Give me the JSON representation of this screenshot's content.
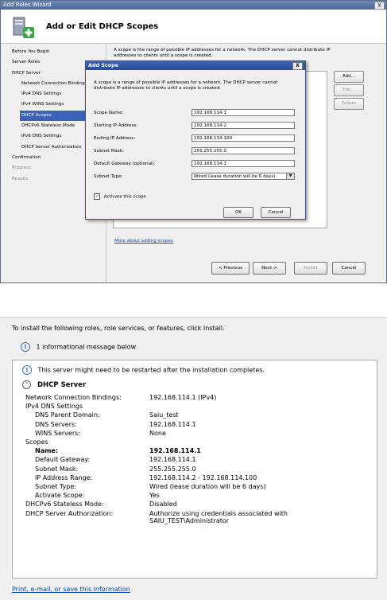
{
  "wizard": {
    "title": "Add Roles Wizard",
    "close_glyph": "X",
    "banner_title": "Add or Edit DHCP Scopes",
    "nav": [
      {
        "label": "Before You Begin",
        "level": 0,
        "state": "normal"
      },
      {
        "label": "Server Roles",
        "level": 0,
        "state": "normal"
      },
      {
        "label": "DHCP Server",
        "level": 0,
        "state": "normal"
      },
      {
        "label": "Network Connection Bindings",
        "level": 1,
        "state": "normal"
      },
      {
        "label": "IPv4 DNS Settings",
        "level": 1,
        "state": "normal"
      },
      {
        "label": "IPv4 WINS Settings",
        "level": 1,
        "state": "normal"
      },
      {
        "label": "DHCP Scopes",
        "level": 1,
        "state": "active"
      },
      {
        "label": "DHCPv6 Stateless Mode",
        "level": 1,
        "state": "normal"
      },
      {
        "label": "IPv6 DNS Settings",
        "level": 1,
        "state": "normal"
      },
      {
        "label": "DHCP Server Authorization",
        "level": 1,
        "state": "normal"
      },
      {
        "label": "Confirmation",
        "level": 0,
        "state": "normal"
      },
      {
        "label": "Progress",
        "level": 0,
        "state": "dim"
      },
      {
        "label": "Results",
        "level": 0,
        "state": "dim"
      }
    ],
    "main_description": "A scope is the range of possible IP addresses for a network. The DHCP server cannot distribute IP addresses to clients until a scope is created.",
    "buttons": {
      "add": "Add...",
      "edit": "Edit...",
      "delete": "Delete"
    },
    "more_link": "More about adding scopes",
    "footer": {
      "previous": "< Previous",
      "next": "Next >",
      "install": "Install",
      "cancel": "Cancel"
    }
  },
  "dialog": {
    "title": "Add Scope",
    "close_glyph": "X",
    "description": "A scope is a range of possible IP addresses for a network. The DHCP server cannot distribute IP addresses to clients until a scope is created.",
    "fields": [
      {
        "label": "Scope Name:",
        "value": "192.168.114.1"
      },
      {
        "label": "Starting IP Address:",
        "value": "192.168.114.2"
      },
      {
        "label": "Ending IP Address:",
        "value": "192.168.114.100"
      },
      {
        "label": "Subnet Mask:",
        "value": "255.255.255.0"
      },
      {
        "label": "Default Gateway (optional):",
        "value": "192.168.114.1"
      }
    ],
    "subnet_type_label": "Subnet Type:",
    "subnet_type_value": "Wired (lease duration will be 6 days)",
    "activate_label": "Activate this scope",
    "activate_checked": true,
    "ok": "OK",
    "cancel": "Cancel"
  },
  "confirmation": {
    "heading": "To install the following roles, role services, or features, click Install.",
    "info_message": "1 informational message below",
    "restart_message": "This server might need to be restarted after the installation completes.",
    "section_title": "DHCP Server",
    "rows": [
      {
        "label": "Network Connection Bindings:",
        "value": "192.168.114.1 (IPv4)",
        "indent": 0,
        "bold": false
      },
      {
        "label": "IPv4 DNS Settings",
        "value": "",
        "indent": 0,
        "bold": false
      },
      {
        "label": "DNS Parent Domain:",
        "value": "Saiu_test",
        "indent": 1,
        "bold": false
      },
      {
        "label": "DNS Servers:",
        "value": "192.168.114.1",
        "indent": 1,
        "bold": false
      },
      {
        "label": "WINS Servers:",
        "value": "None",
        "indent": 1,
        "bold": false
      },
      {
        "label": "Scopes",
        "value": "",
        "indent": 0,
        "bold": false
      },
      {
        "label": "Name:",
        "value": "192.168.114.1",
        "indent": 1,
        "bold": true
      },
      {
        "label": "Default Gateway:",
        "value": "192.168.114.1",
        "indent": 1,
        "bold": false
      },
      {
        "label": "Subnet Mask:",
        "value": "255.255.255.0",
        "indent": 1,
        "bold": false
      },
      {
        "label": "IP Address Range:",
        "value": "192.168.114.2 - 192.168.114.100",
        "indent": 1,
        "bold": false
      },
      {
        "label": "Subnet Type:",
        "value": "Wired (lease duration will be 6 days)",
        "indent": 1,
        "bold": false
      },
      {
        "label": "Activate Scope:",
        "value": "Yes",
        "indent": 1,
        "bold": false
      },
      {
        "label": "DHCPv6 Stateless Mode:",
        "value": "Disabled",
        "indent": 0,
        "bold": false
      },
      {
        "label": "DHCP Server Authorization:",
        "value": "Authorize using credentials associated with",
        "indent": 0,
        "bold": false
      },
      {
        "label": "",
        "value": "SAIU_TEST\\Administrator",
        "indent": 0,
        "bold": false
      }
    ],
    "link": "Print, e-mail, or save this information"
  }
}
